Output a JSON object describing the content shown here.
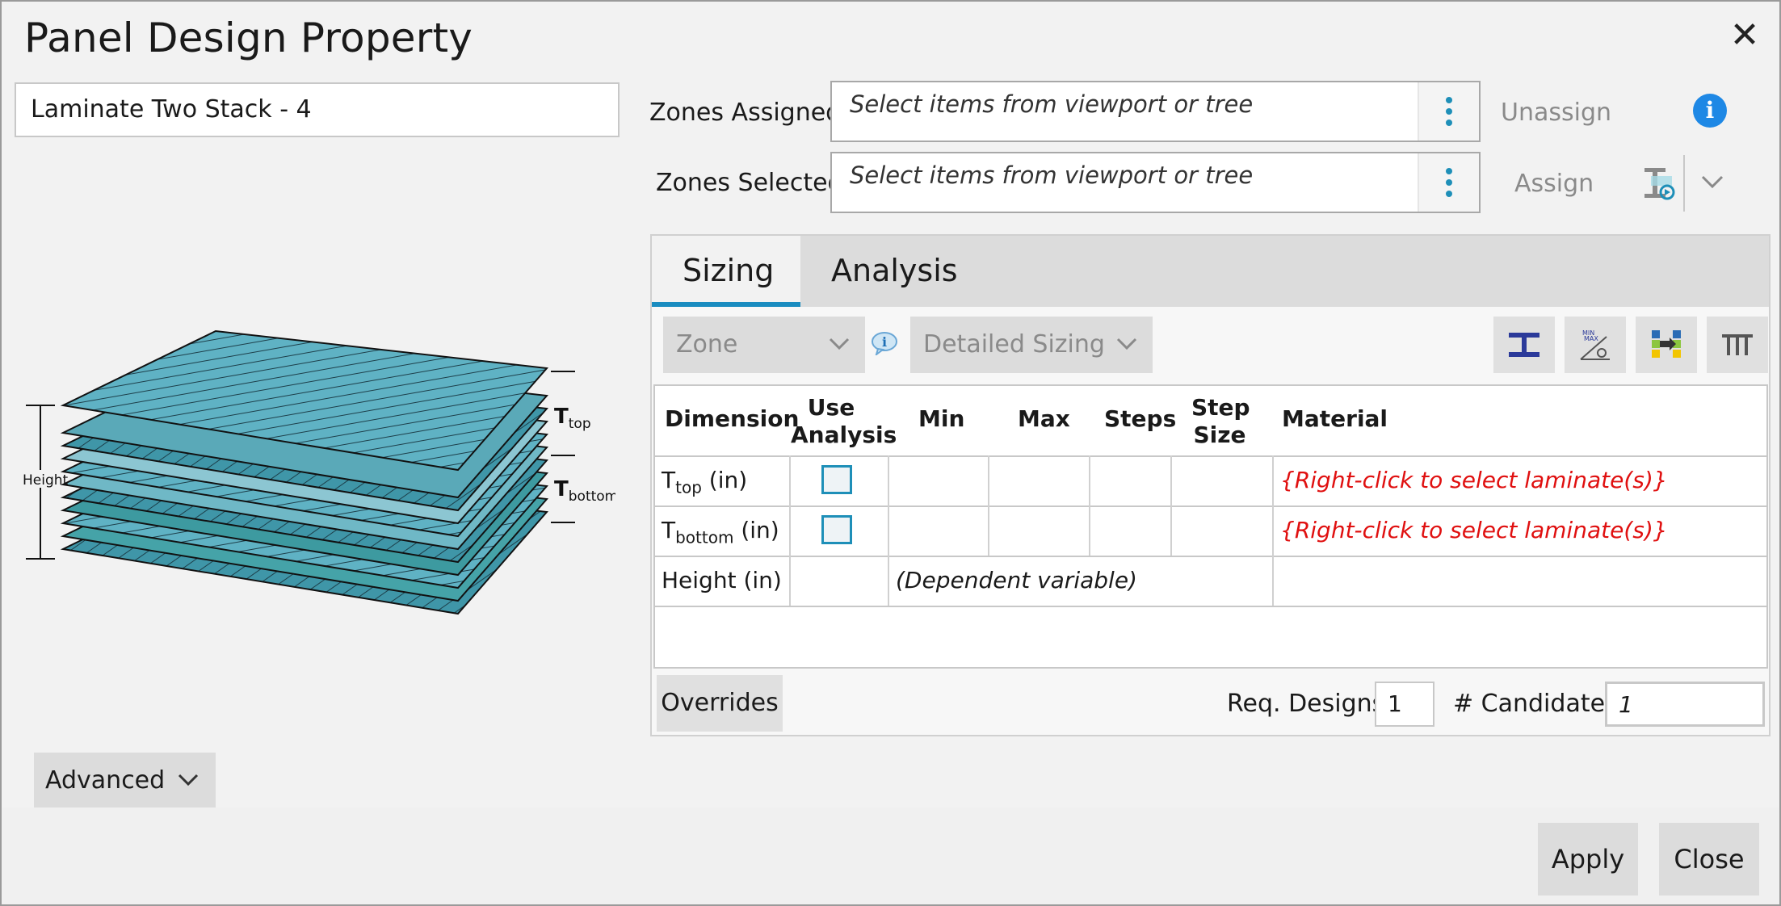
{
  "window": {
    "title": "Panel Design Property",
    "close_glyph": "✕"
  },
  "property_name": "Laminate Two Stack - 4",
  "zones": {
    "assigned_label": "Zones Assigned:",
    "assigned_placeholder": "Select items from viewport or tree",
    "selected_label": "Zones Selected:",
    "selected_placeholder": "Select items from viewport or tree",
    "unassign_label": "Unassign",
    "assign_label": "Assign",
    "info_glyph": "i"
  },
  "illustration": {
    "height_label": "Height",
    "t_top_main": "T",
    "t_top_sub": "top",
    "t_bottom_main": "T",
    "t_bottom_sub": "bottom"
  },
  "tabs": [
    {
      "label": "Sizing",
      "active": true
    },
    {
      "label": "Analysis",
      "active": false
    }
  ],
  "filters": {
    "zone_combo": "Zone",
    "sizing_combo": "Detailed Sizing"
  },
  "toolbar_icons": [
    "i-beam-icon",
    "min-max-icon",
    "material-map-icon",
    "stiffener-icon"
  ],
  "table": {
    "headers": {
      "dimension": "Dimension",
      "use_analysis_1": "Use",
      "use_analysis_2": "Analysis",
      "min": "Min",
      "max": "Max",
      "steps": "Steps",
      "step_size_1": "Step",
      "step_size_2": "Size",
      "material": "Material"
    },
    "rows": [
      {
        "dim_main": "T",
        "dim_sub": "top",
        "dim_unit": " (in)",
        "use_analysis": false,
        "material": "{Right-click to select laminate(s)}"
      },
      {
        "dim_main": "T",
        "dim_sub": "bottom",
        "dim_unit": " (in)",
        "use_analysis": false,
        "material": "{Right-click to select laminate(s)}"
      },
      {
        "dim_label": "Height (in)",
        "note": "(Dependent variable)"
      }
    ]
  },
  "footer": {
    "overrides_label": "Overrides",
    "req_designs_label": "Req. Designs",
    "req_designs_value": "1",
    "candidates_label": "# Candidates",
    "candidates_value": "1"
  },
  "advanced_label": "Advanced",
  "actions": {
    "apply_label": "Apply",
    "close_label": "Close"
  },
  "colors": {
    "accent": "#1a8cc0",
    "info_blue": "#1e88e5",
    "warning_red": "#e01010",
    "ply_teal": "#4aa3b5"
  }
}
